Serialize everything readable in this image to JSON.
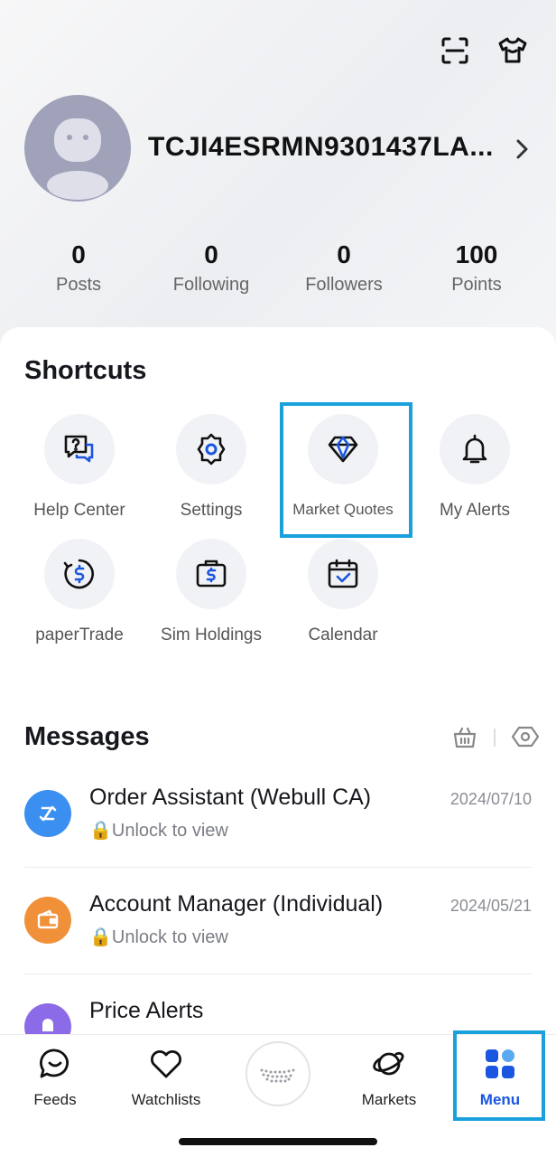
{
  "profile": {
    "username": "TCJI4ESRMN9301437LA...",
    "stats": [
      {
        "value": "0",
        "label": "Posts"
      },
      {
        "value": "0",
        "label": "Following"
      },
      {
        "value": "0",
        "label": "Followers"
      },
      {
        "value": "100",
        "label": "Points"
      }
    ]
  },
  "shortcuts": {
    "title": "Shortcuts",
    "items": [
      {
        "label": "Help Center",
        "icon": "help-chat-icon"
      },
      {
        "label": "Settings",
        "icon": "gear-icon"
      },
      {
        "label": "Market Quotes",
        "icon": "diamond-icon"
      },
      {
        "label": "My Alerts",
        "icon": "bell-icon"
      },
      {
        "label": "paperTrade",
        "icon": "dollar-refresh-icon"
      },
      {
        "label": "Sim Holdings",
        "icon": "briefcase-dollar-icon"
      },
      {
        "label": "Calendar",
        "icon": "calendar-check-icon"
      }
    ]
  },
  "messages": {
    "title": "Messages",
    "items": [
      {
        "title": "Order Assistant (Webull CA)",
        "date": "2024/07/10",
        "subtitle": "🔒Unlock to view",
        "color": "#3b8ff0"
      },
      {
        "title": "Account Manager (Individual)",
        "date": "2024/05/21",
        "subtitle": "🔒Unlock to view",
        "color": "#f0913a"
      },
      {
        "title": "Price Alerts",
        "color": "#8b6be8"
      }
    ]
  },
  "tabbar": {
    "items": [
      {
        "label": "Feeds",
        "icon": "feeds-icon"
      },
      {
        "label": "Watchlists",
        "icon": "heart-icon"
      },
      {
        "label": "Markets",
        "icon": "planet-icon"
      },
      {
        "label": "Menu",
        "icon": "menu-grid-icon",
        "active": true
      }
    ]
  },
  "colors": {
    "accent": "#1a56e0",
    "highlight": "#1aa1dc"
  }
}
